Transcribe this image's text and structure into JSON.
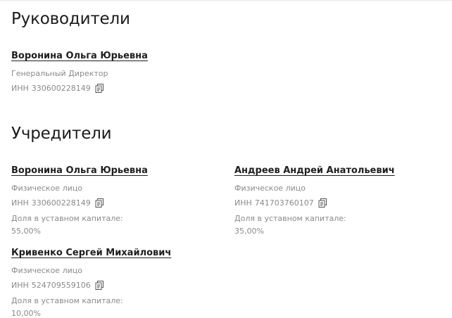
{
  "managers": {
    "title": "Руководители",
    "items": [
      {
        "name": "Воронина Ольга Юрьевна",
        "role": "Генеральный Директор",
        "inn_label": "ИНН",
        "inn": "330600228149"
      }
    ]
  },
  "founders": {
    "title": "Учредители",
    "share_label": "Доля в уставном капитале:",
    "items": [
      {
        "name": "Воронина Ольга Юрьевна",
        "type": "Физическое лицо",
        "inn_label": "ИНН",
        "inn": "330600228149",
        "share_label": "Доля в уставном капитале:",
        "share": "55,00%"
      },
      {
        "name": "Андреев Андрей Анатольевич",
        "type": "Физическое лицо",
        "inn_label": "ИНН",
        "inn": "741703760107",
        "share_label": "Доля в уставном капитале:",
        "share": "35,00%"
      },
      {
        "name": "Кривенко Сергей Михайлович",
        "type": "Физическое лицо",
        "inn_label": "ИНН",
        "inn": "524709559106",
        "share_label": "Доля в уставном капитале:",
        "share": "10,00%"
      }
    ]
  },
  "icons": {
    "copy": "copy-icon"
  },
  "colors": {
    "text": "#1f1f1f",
    "muted": "#8a8a8a",
    "background": "#ffffff"
  }
}
